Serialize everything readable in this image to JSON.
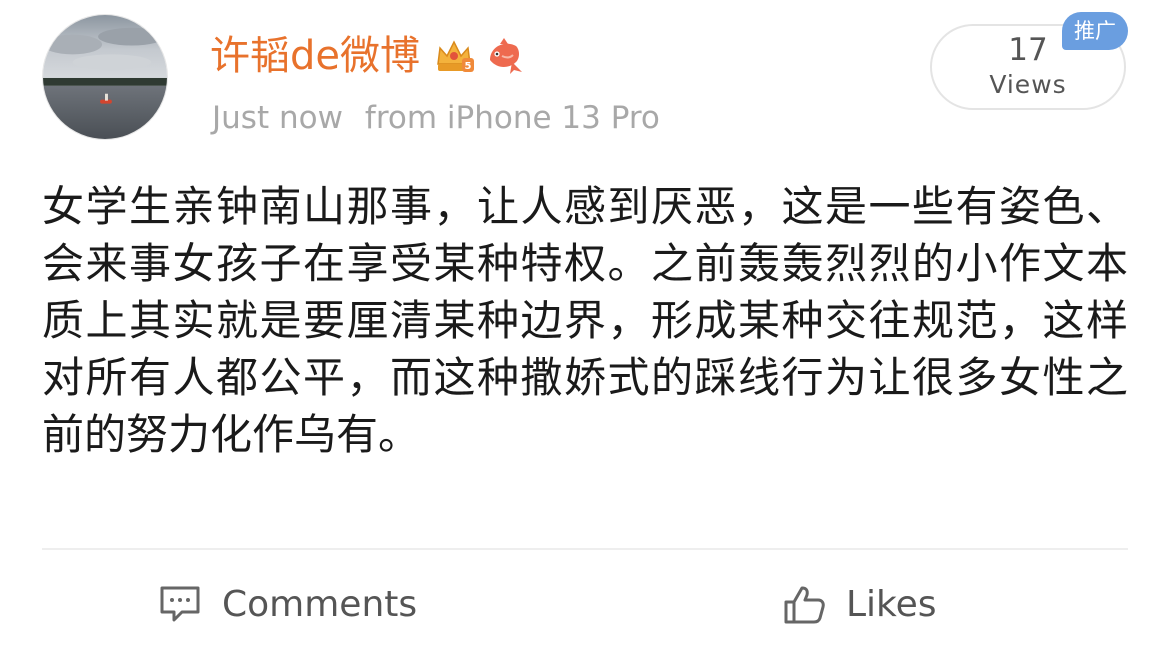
{
  "post": {
    "username": "许韬de微博",
    "badges": [
      "crown-level-5-icon",
      "koi-fish-icon"
    ],
    "timestamp": "Just now",
    "source": "from iPhone 13 Pro",
    "views": {
      "count": "17",
      "label": "Views"
    },
    "promo_tag": "推广",
    "text": "女学生亲钟南山那事，让人感到厌恶，这是一些有姿色、会来事女孩子在享受某种特权。之前轰轰烈烈的小作文本质上其实就是要厘清某种边界，形成某种交往规范，这样对所有人都公平，而这种撒娇式的踩线行为让很多女性之前的努力化作乌有。"
  },
  "actions": {
    "comments_label": "Comments",
    "likes_label": "Likes"
  },
  "colors": {
    "username": "#e8722c",
    "meta": "#a8a8a8",
    "promo_bg": "#6a9ee0",
    "action_text": "#555555"
  }
}
